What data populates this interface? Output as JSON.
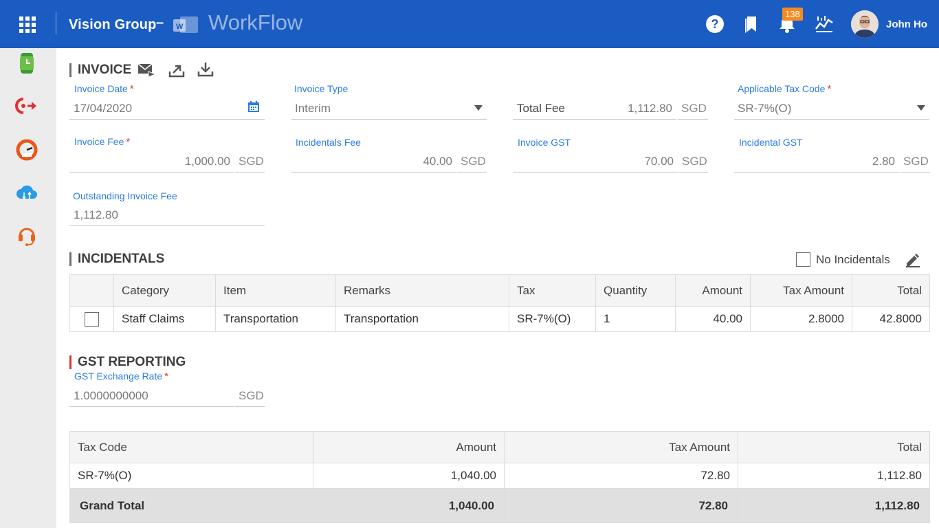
{
  "header": {
    "company": "Vision Group",
    "separator": "–",
    "app_name": "WorkFlow",
    "notification_count": "138",
    "user_name": "John Ho",
    "accent": "#1b5cc2"
  },
  "sidebar": {
    "items": [
      "timesheet-icon",
      "redirect-icon",
      "dashboard-gauge-icon",
      "cloud-sync-icon",
      "support-headset-icon"
    ]
  },
  "invoice": {
    "title": "INVOICE",
    "invoice_date": {
      "label": "Invoice Date",
      "value": "17/04/2020"
    },
    "invoice_type": {
      "label": "Invoice Type",
      "value": "Interim"
    },
    "total_fee": {
      "label": "Total Fee",
      "value": "1,112.80",
      "unit": "SGD"
    },
    "tax_code": {
      "label": "Applicable Tax Code",
      "value": "SR-7%(O)"
    },
    "invoice_fee": {
      "label": "Invoice Fee",
      "value": "1,000.00",
      "unit": "SGD"
    },
    "incidentals_fee": {
      "label": "Incidentals Fee",
      "value": "40.00",
      "unit": "SGD"
    },
    "invoice_gst": {
      "label": "Invoice GST",
      "value": "70.00",
      "unit": "SGD"
    },
    "incidental_gst": {
      "label": "Incidental GST",
      "value": "2.80",
      "unit": "SGD"
    },
    "outstanding": {
      "label": "Outstanding Invoice Fee",
      "value": "1,112.80"
    }
  },
  "incidentals": {
    "title": "INCIDENTALS",
    "no_incidentals_label": "No Incidentals",
    "columns": [
      "Category",
      "Item",
      "Remarks",
      "Tax",
      "Quantity",
      "Amount",
      "Tax Amount",
      "Total"
    ],
    "rows": [
      {
        "category": "Staff Claims",
        "item": "Transportation",
        "remarks": "Transportation",
        "tax": "SR-7%(O)",
        "quantity": "1",
        "amount": "40.00",
        "tax_amount": "2.8000",
        "total": "42.8000"
      }
    ]
  },
  "gst": {
    "title": "GST REPORTING",
    "rate_label": "GST Exchange Rate",
    "rate_value": "1.0000000000",
    "rate_unit": "SGD",
    "columns": [
      "Tax Code",
      "Amount",
      "Tax Amount",
      "Total"
    ],
    "rows": [
      {
        "tax_code": "SR-7%(O)",
        "amount": "1,040.00",
        "tax_amount": "72.80",
        "total": "1,112.80"
      }
    ],
    "grand_total": {
      "label": "Grand Total",
      "amount": "1,040.00",
      "tax_amount": "72.80",
      "total": "1,112.80"
    }
  }
}
